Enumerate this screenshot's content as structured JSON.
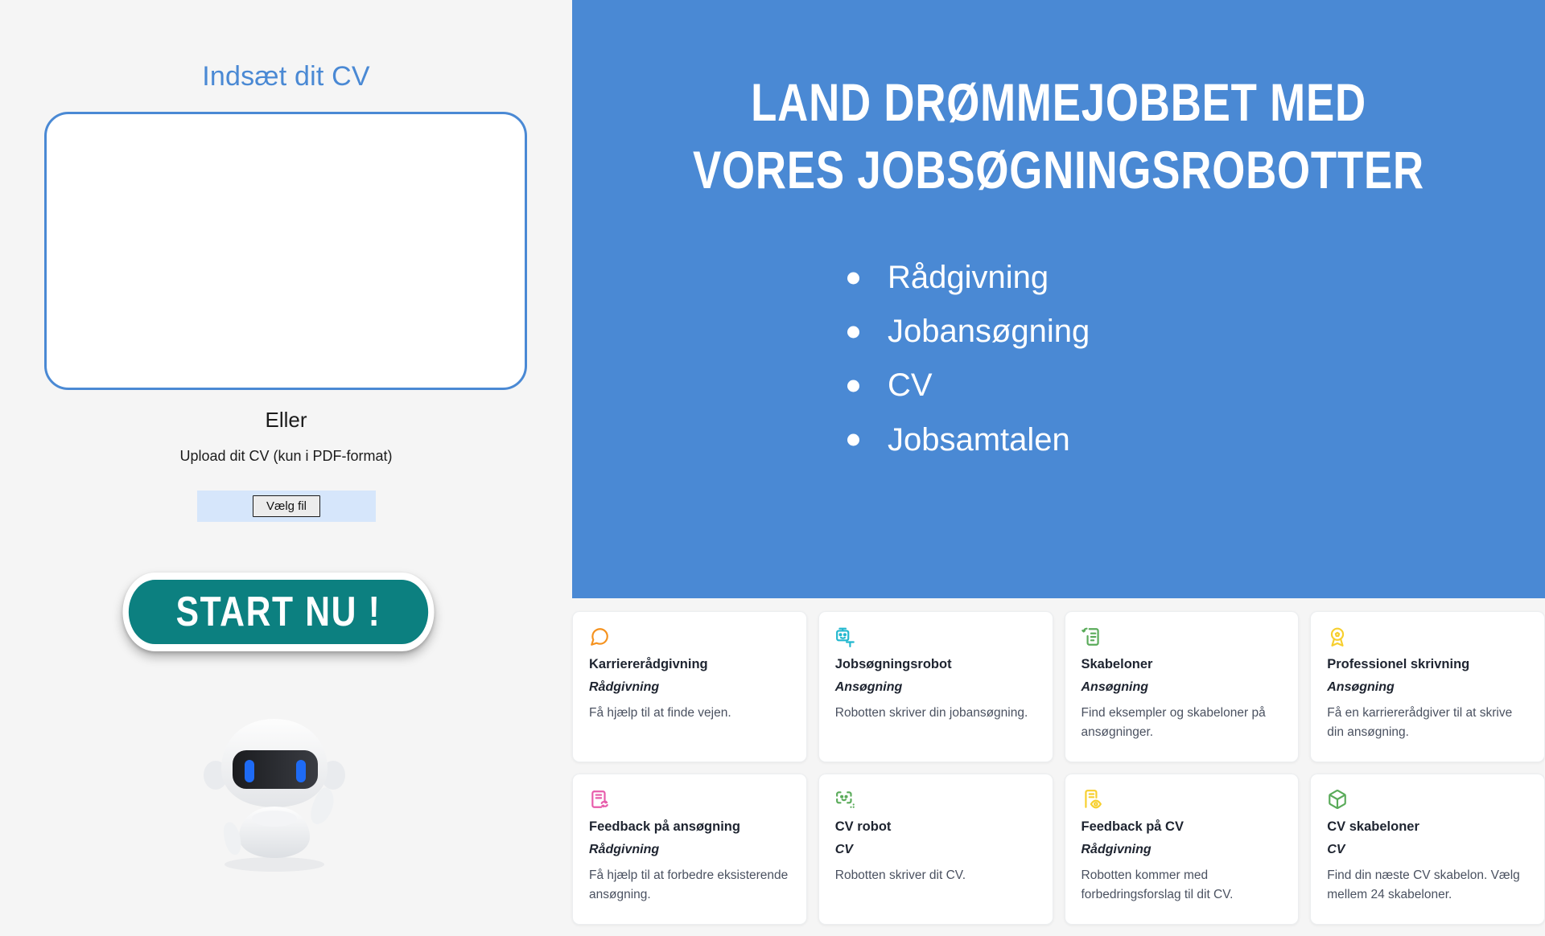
{
  "left_panel": {
    "cv_title": "Indsæt dit CV",
    "cv_textarea_value": "",
    "cv_textarea_placeholder": "",
    "or_label": "Eller",
    "upload_label": "Upload dit CV (kun i PDF-format)",
    "file_button_label": "Vælg fil",
    "start_button_label": "START NU !",
    "robot_icon": "robot-mascot-icon"
  },
  "hero": {
    "title": "Land drømmejobbet med vores jobsøgningsrobotter",
    "background_color": "#4a89d4",
    "bullets": [
      "Rådgivning",
      "Jobansøgning",
      "CV",
      "Jobsamtalen"
    ]
  },
  "cards": [
    {
      "icon": "speech-bubble-icon",
      "icon_color": "#f5921e",
      "title": "Karriererådgivning",
      "category": "Rådgivning",
      "description": "Få hjælp til at finde vejen."
    },
    {
      "icon": "robot-text-icon",
      "icon_color": "#22b8cf",
      "title": "Jobsøgningsrobot",
      "category": "Ansøgning",
      "description": "Robotten skriver din jobansøgning."
    },
    {
      "icon": "document-refresh-icon",
      "icon_color": "#5aab5a",
      "title": "Skabeloner",
      "category": "Ansøgning",
      "description": "Find eksempler og skabeloner på ansøgninger."
    },
    {
      "icon": "award-badge-icon",
      "icon_color": "#f7cf2e",
      "title": "Professionel skrivning",
      "category": "Ansøgning",
      "description": "Få en karriererådgiver til at skrive din ansøgning."
    },
    {
      "icon": "document-feedback-icon",
      "icon_color": "#e75cab",
      "title": "Feedback på ansøgning",
      "category": "Rådgivning",
      "description": "Få hjælp til at forbedre eksisterende ansøgning."
    },
    {
      "icon": "robot-scan-icon",
      "icon_color": "#5aab5a",
      "title": "CV robot",
      "category": "CV",
      "description": "Robotten skriver dit CV."
    },
    {
      "icon": "document-eye-icon",
      "icon_color": "#f7cf2e",
      "title": "Feedback på CV",
      "category": "Rådgivning",
      "description": "Robotten kommer med forbedringsforslag til dit CV."
    },
    {
      "icon": "box-3d-icon",
      "icon_color": "#5aab5a",
      "title": "CV skabeloner",
      "category": "CV",
      "description": "Find din næste CV skabelon. Vælg mellem 24 skabeloner."
    }
  ],
  "colors": {
    "page_background": "#f5f5f5",
    "accent_blue": "#4a89d4",
    "start_button_teal": "#0c8080",
    "file_input_background": "#d6e6fb"
  }
}
